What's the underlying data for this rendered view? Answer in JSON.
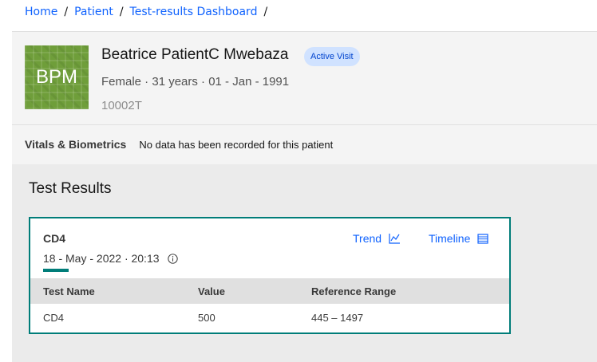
{
  "breadcrumb": {
    "items": [
      "Home",
      "Patient",
      "Test-results Dashboard"
    ],
    "separator": "/"
  },
  "patient": {
    "initials": "BPM",
    "name": "Beatrice PatientC Mwebaza",
    "visit_badge": "Active Visit",
    "info": "Female · 31 years · 01 - Jan - 1991",
    "id": "10002T"
  },
  "vitals": {
    "title": "Vitals & Biometrics",
    "message": "No data has been recorded for this patient"
  },
  "results": {
    "title": "Test Results",
    "card": {
      "title": "CD4",
      "date": "18 - May - 2022 · 20:13",
      "trend_label": "Trend",
      "timeline_label": "Timeline",
      "columns": [
        "Test Name",
        "Value",
        "Reference Range"
      ],
      "rows": [
        {
          "name": "CD4",
          "value": "500",
          "range": "445 – 1497"
        }
      ]
    }
  },
  "colors": {
    "link": "#0f62fe",
    "teal_accent": "#007d79",
    "badge_bg": "#d0e2ff",
    "badge_text": "#0043ce",
    "avatar_bg": "#6f9e3a"
  },
  "icons": [
    "info-icon",
    "trend-chart-icon",
    "timeline-table-icon"
  ]
}
